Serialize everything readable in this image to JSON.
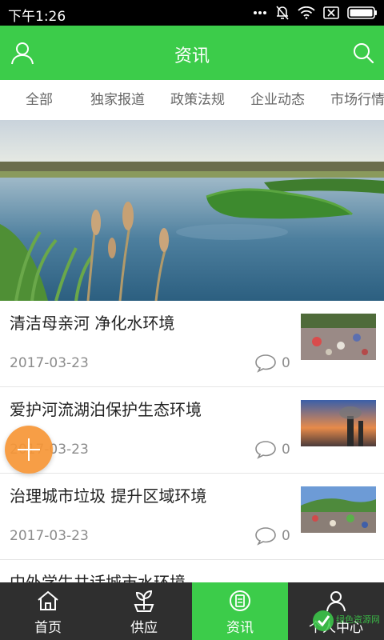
{
  "status_bar": {
    "time": "下午1:26",
    "icons": [
      "more-dots-icon",
      "notifications-muted-icon",
      "wifi-icon",
      "sim-off-icon",
      "battery-icon"
    ]
  },
  "header": {
    "title": "资讯",
    "left_icon": "user-icon",
    "right_icon": "search-icon",
    "background_color": "#3ccc4a"
  },
  "category_tabs": [
    {
      "label": "全部"
    },
    {
      "label": "独家报道"
    },
    {
      "label": "政策法规"
    },
    {
      "label": "企业动态"
    },
    {
      "label": "市场行情"
    }
  ],
  "news": [
    {
      "title": "清洁母亲河 净化水环境",
      "date": "2017-03-23",
      "comments": "0"
    },
    {
      "title": "爱护河流湖泊保护生态环境",
      "date": "2017-03-23",
      "comments": "0"
    },
    {
      "title": "治理城市垃圾 提升区域环境",
      "date": "2017-03-23",
      "comments": "0"
    },
    {
      "title": "中外学生共话城市水环境",
      "date": "",
      "comments": ""
    }
  ],
  "fab": {
    "icon": "plus-icon",
    "color": "#f69636"
  },
  "bottom_nav": [
    {
      "label": "首页",
      "icon": "home-icon",
      "active": false
    },
    {
      "label": "供应",
      "icon": "supply-icon",
      "active": false
    },
    {
      "label": "资讯",
      "icon": "news-icon",
      "active": true
    },
    {
      "label": "个人中心",
      "icon": "person-icon",
      "active": false
    }
  ],
  "watermark": {
    "text": "绿色资源网"
  },
  "colors": {
    "accent": "#3ccc4a",
    "nav_background": "#2f2f2f",
    "text_secondary": "#8c8c8c"
  }
}
